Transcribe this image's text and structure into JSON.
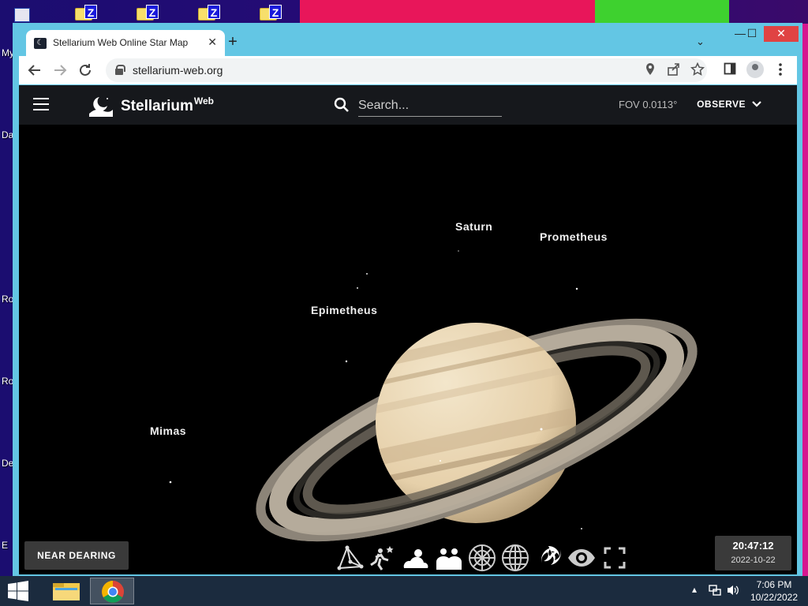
{
  "desktop": {
    "labels": [
      "My",
      "Da",
      "Ro",
      "Ro",
      "De",
      "E"
    ]
  },
  "browser": {
    "tab": {
      "title": "Stellarium Web Online Star Map",
      "close": "✕"
    },
    "new_tab": "+",
    "window": {
      "minimize": "—",
      "maximize": "☐",
      "close": "✕",
      "tab_list": "⌄"
    },
    "url": "stellarium-web.org"
  },
  "app": {
    "brand": "Stellarium",
    "brand_sup": "Web",
    "search_placeholder": "Search...",
    "fov": "FOV 0.0113°",
    "observe_label": "OBSERVE",
    "location_label": "NEAR DEARING",
    "time": "20:47:12",
    "date": "2022-10-22",
    "sky_labels": [
      {
        "name": "Saturn"
      },
      {
        "name": "Prometheus"
      },
      {
        "name": "Epimetheus"
      },
      {
        "name": "Mimas"
      }
    ],
    "bottom_icons": [
      "constellation-lines-icon",
      "constellation-art-icon",
      "atmosphere-icon",
      "landscape-icon",
      "azimuthal-grid-icon",
      "equatorial-grid-icon",
      "deep-sky-objects-icon",
      "night-mode-icon",
      "fullscreen-icon"
    ]
  },
  "taskbar": {
    "clock_time": "7:06 PM",
    "clock_date": "10/22/2022"
  }
}
